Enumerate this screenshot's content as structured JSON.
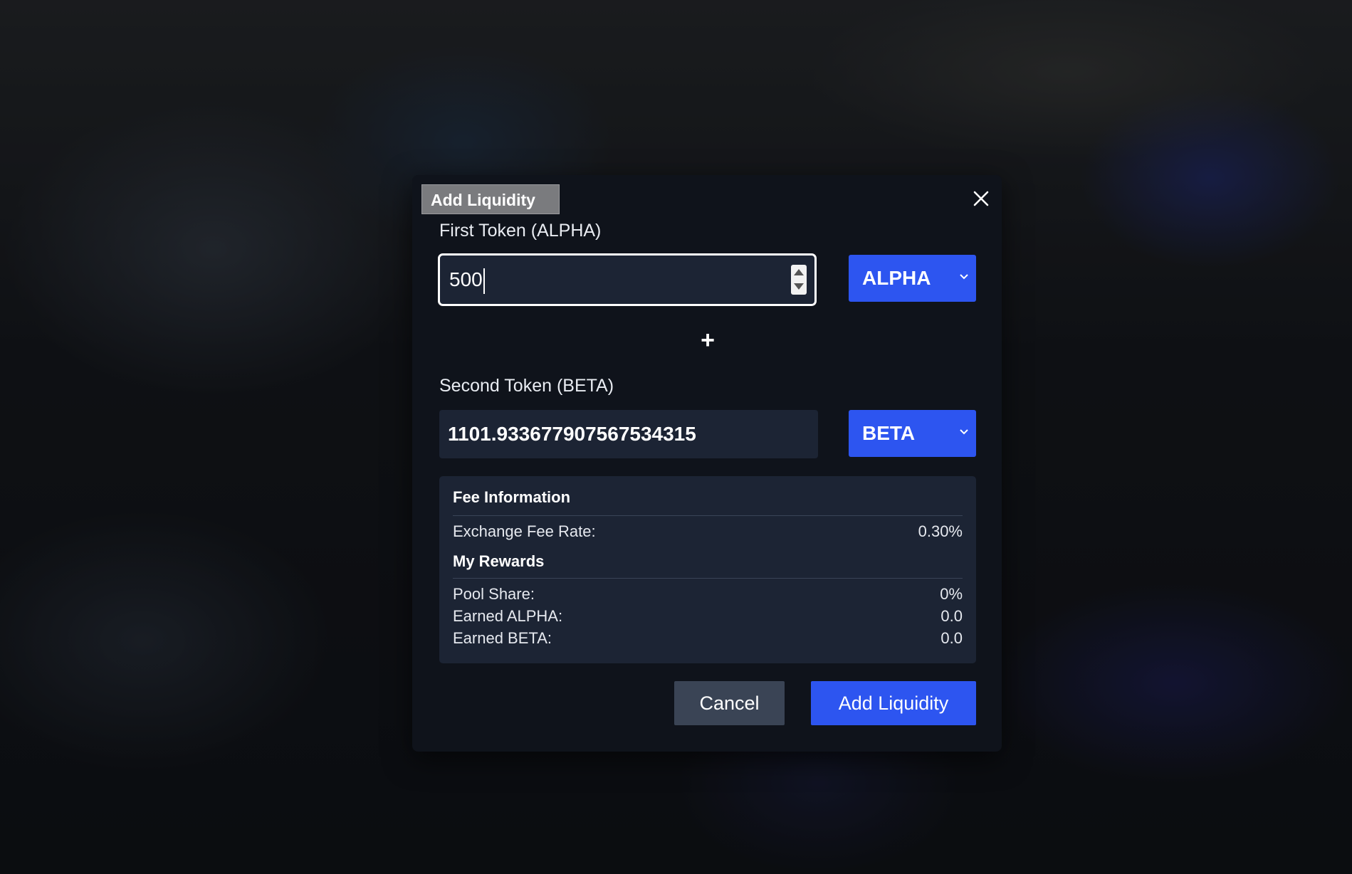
{
  "modal": {
    "title": "Add Liquidity",
    "close_icon": "close-icon"
  },
  "first_token": {
    "label": "First Token (ALPHA)",
    "amount": "500",
    "selected_token": "ALPHA"
  },
  "plus_symbol": "+",
  "second_token": {
    "label": "Second Token (BETA)",
    "amount": "1101.933677907567534315",
    "selected_token": "BETA"
  },
  "fee_info": {
    "heading": "Fee Information",
    "exchange_fee_label": "Exchange Fee Rate:",
    "exchange_fee_value": "0.30%",
    "rewards_heading": "My Rewards",
    "pool_share_label": "Pool Share:",
    "pool_share_value": "0%",
    "earned_alpha_label": "Earned ALPHA:",
    "earned_alpha_value": "0.0",
    "earned_beta_label": "Earned BETA:",
    "earned_beta_value": "0.0"
  },
  "actions": {
    "cancel_label": "Cancel",
    "add_label": "Add Liquidity"
  },
  "colors": {
    "accent": "#2d55f0",
    "modal_bg": "#0f131b",
    "panel_bg": "#1c2434"
  }
}
